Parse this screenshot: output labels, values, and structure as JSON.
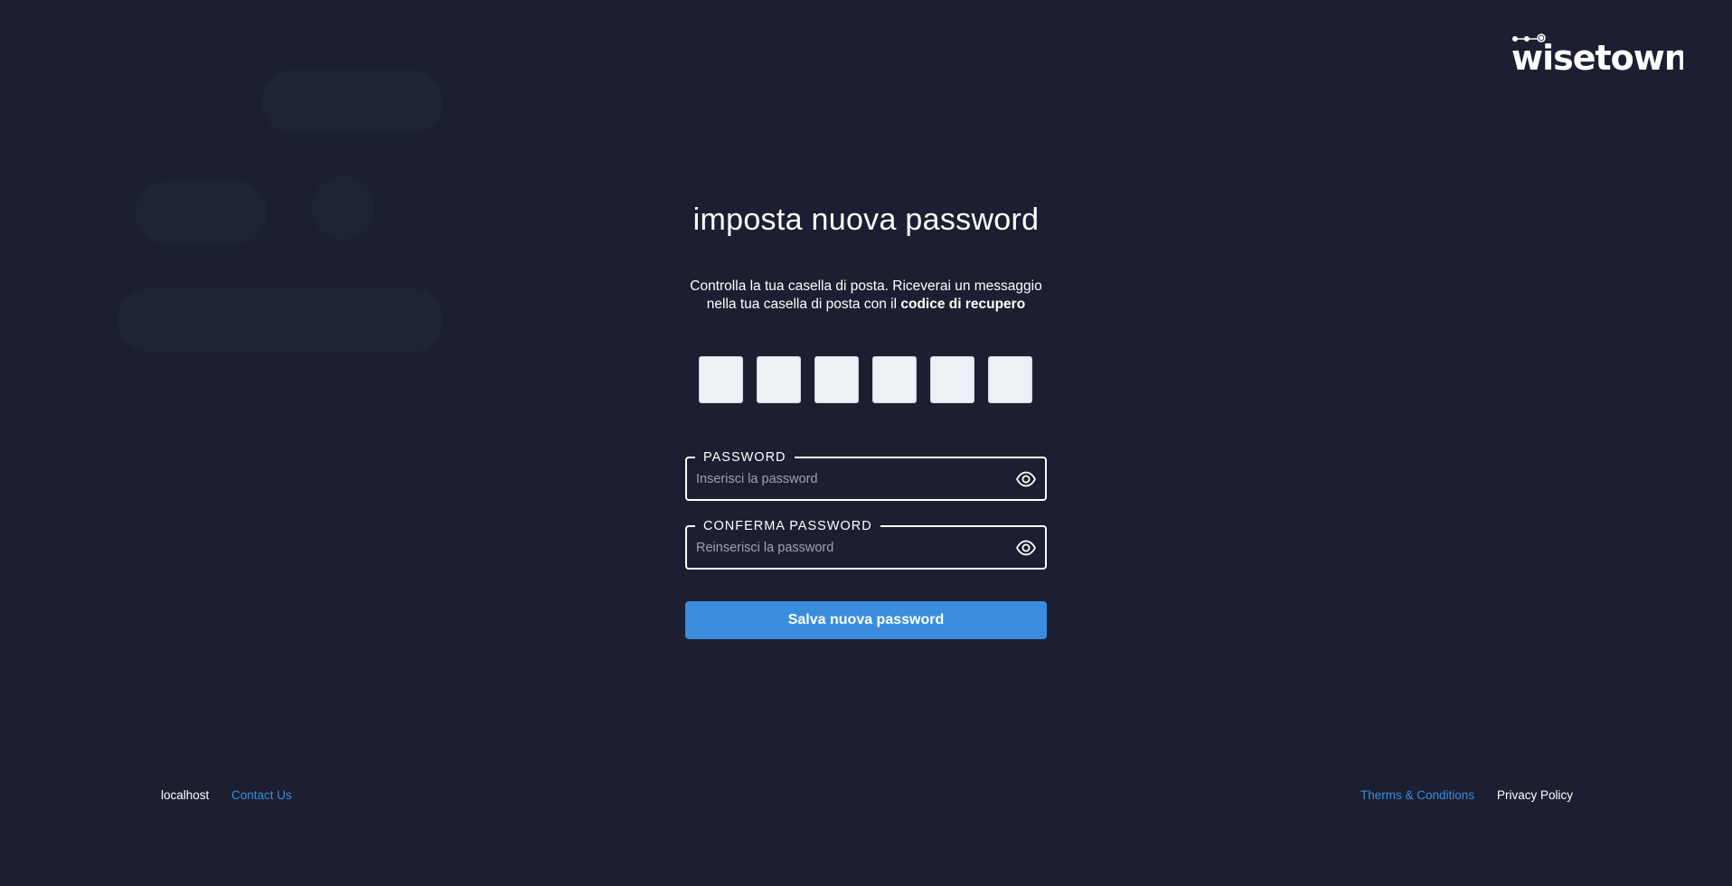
{
  "brand": {
    "logo_text": "wisetown",
    "accent_color": "#3a8ddd",
    "background_color": "#1c1f31"
  },
  "form": {
    "title": "imposta nuova password",
    "subtitle_lead": "Controlla la tua casella di posta. Riceverai un messaggio nella tua casella di posta con il",
    "subtitle_bold": "codice di recupero",
    "code_boxes": [
      "",
      "",
      "",
      "",
      "",
      ""
    ],
    "password": {
      "label": "PASSWORD",
      "placeholder": "Inserisci la password",
      "value": "",
      "toggle_icon": "eye-icon"
    },
    "confirm_password": {
      "label": "CONFERMA PASSWORD",
      "placeholder": "Reinserisci la password",
      "value": "",
      "toggle_icon": "eye-icon"
    },
    "submit_label": "Salva nuova password"
  },
  "footer": {
    "host": "localhost",
    "contact": "Contact Us",
    "terms": "Therms & Conditions",
    "privacy": "Privacy Policy"
  }
}
